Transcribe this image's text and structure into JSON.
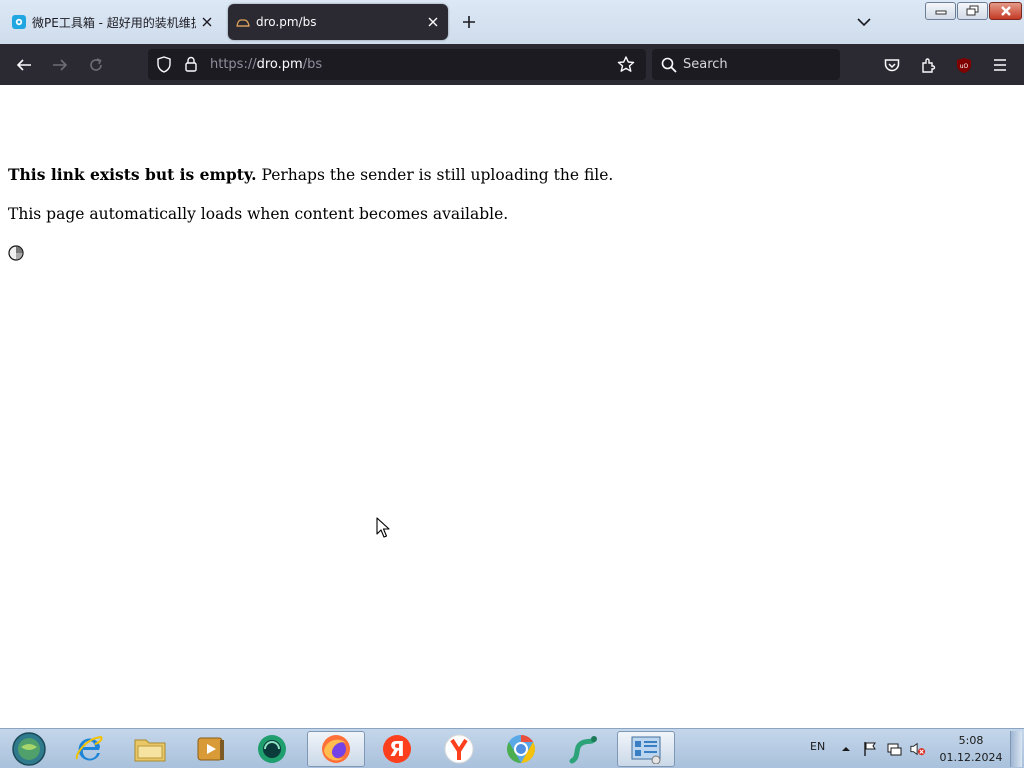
{
  "browser": {
    "tabs": [
      {
        "title": "微PE工具箱 - 超好用的装机维护",
        "active": false
      },
      {
        "title": "dro.pm/bs",
        "active": true
      }
    ],
    "url": {
      "scheme": "https://",
      "host": "dro.pm",
      "path": "/bs"
    },
    "search": {
      "placeholder": "Search"
    },
    "icons": [
      "back-arrow-icon",
      "forward-arrow-icon",
      "reload-icon",
      "shield-icon",
      "lock-icon",
      "star-icon",
      "search-icon",
      "pocket-icon",
      "extensions-icon",
      "ublock-icon",
      "menu-icon"
    ],
    "ublock_badge": "uO"
  },
  "page": {
    "bold_text": "This link exists but is empty.",
    "rest_text": " Perhaps the sender is still uploading the file.",
    "auto_text": "This page automatically loads when content becomes available."
  },
  "taskbar": {
    "apps": [
      "start-orb",
      "internet-explorer",
      "file-explorer",
      "media-player",
      "app-green",
      "firefox",
      "yandex-browser-ya",
      "yandex-browser",
      "chromium",
      "app-serpent",
      "control-panel"
    ],
    "language": "EN",
    "time": "5:08",
    "date": "01.12.2024"
  },
  "colors": {
    "nav_bg": "#2b2a33",
    "urlbar_bg": "#1c1b22",
    "tabstrip_bg": "#d4e1f0",
    "page_bg": "#ffffff"
  }
}
